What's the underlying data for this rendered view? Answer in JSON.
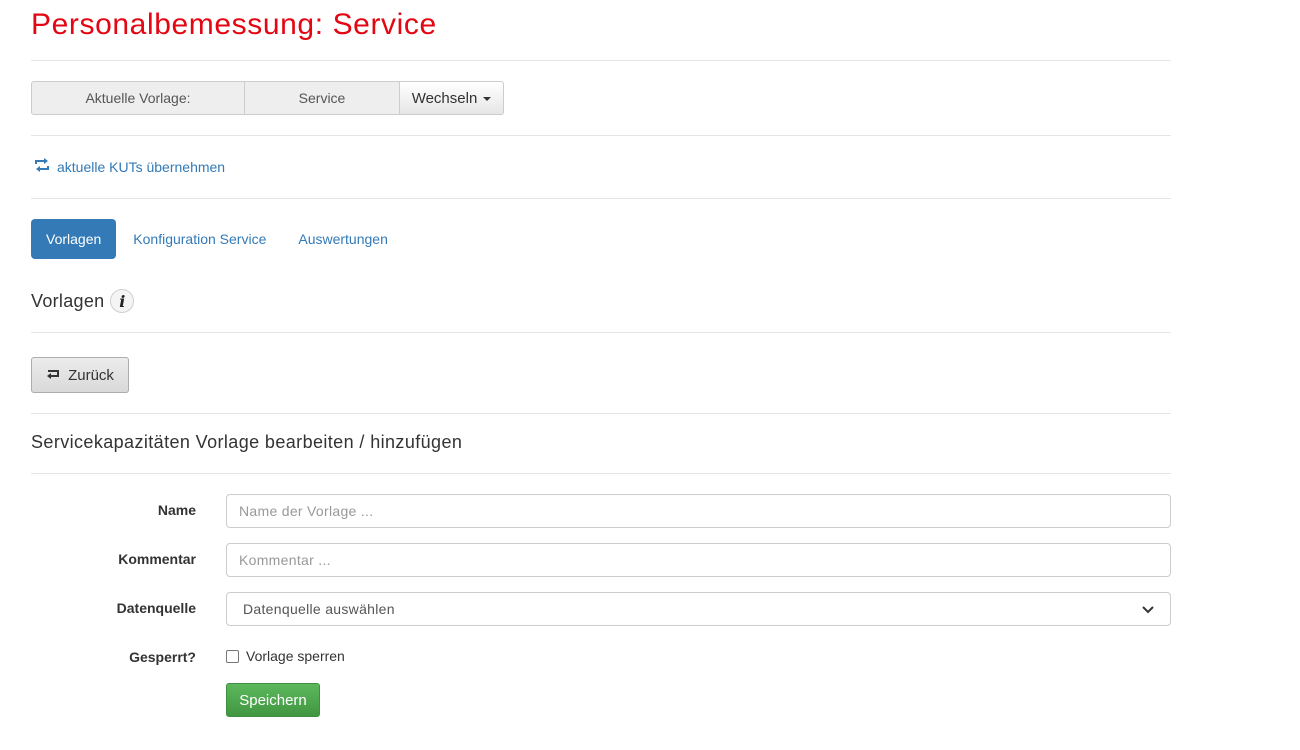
{
  "page": {
    "title": "Personalbemessung: Service"
  },
  "template_selector": {
    "label": "Aktuelle Vorlage:",
    "current": "Service",
    "switch_button": "Wechseln"
  },
  "actions": {
    "apply_kuts": "aktuelle KUTs übernehmen"
  },
  "tabs": [
    {
      "label": "Vorlagen",
      "active": true
    },
    {
      "label": "Konfiguration Service",
      "active": false
    },
    {
      "label": "Auswertungen",
      "active": false
    }
  ],
  "section": {
    "title": "Vorlagen",
    "info_icon": "i"
  },
  "back_button": {
    "label": "Zurück"
  },
  "form": {
    "title": "Servicekapazitäten Vorlage bearbeiten / hinzufügen",
    "name": {
      "label": "Name",
      "placeholder": "Name der Vorlage ...",
      "value": ""
    },
    "comment": {
      "label": "Kommentar",
      "placeholder": "Kommentar ...",
      "value": ""
    },
    "datasource": {
      "label": "Datenquelle",
      "selected": "Datenquelle auswählen"
    },
    "locked": {
      "label": "Gesperrt?",
      "checkbox_label": "Vorlage sperren",
      "checked": false
    },
    "save_button": "Speichern"
  },
  "colors": {
    "title_red": "#e30613",
    "primary_blue": "#337ab7",
    "success_green": "#5cb85c"
  }
}
